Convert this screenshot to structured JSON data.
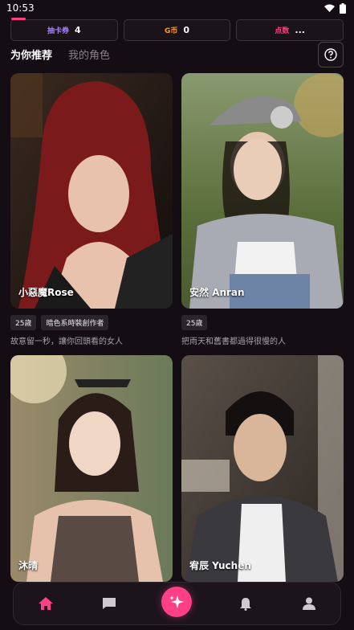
{
  "status": {
    "time": "10:53"
  },
  "stats": [
    {
      "label": "抽卡券",
      "value": "4",
      "color": "#a783ff"
    },
    {
      "label": "G币",
      "value": "0",
      "color": "#ff9a2d"
    },
    {
      "label": "点数",
      "value": "...",
      "color": "#ff3b7a"
    }
  ],
  "tabs": {
    "recommended": "为你推荐",
    "my_roles": "我的角色"
  },
  "cards": [
    {
      "name": "小惡魔Rose",
      "tags": [
        "25歲",
        "暗色系時裝創作者"
      ],
      "desc": "故意留一秒，讓你回頭看的女人"
    },
    {
      "name": "安然 Anran",
      "tags": [
        "25歲"
      ],
      "desc": "把雨天和舊書都過得很慢的人"
    },
    {
      "name": "沐晴"
    },
    {
      "name": "宥辰 Yuchen"
    }
  ],
  "colors": {
    "accent": "#ff3f86",
    "background": "#140d14"
  }
}
